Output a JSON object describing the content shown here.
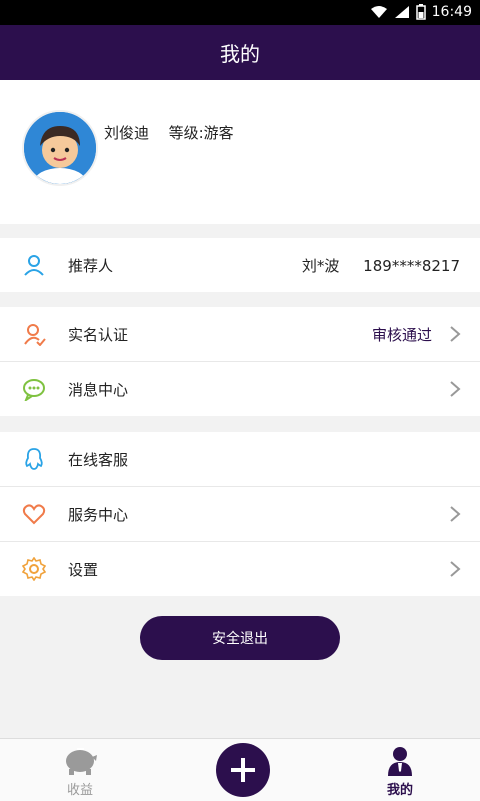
{
  "status_bar": {
    "time": "16:49"
  },
  "header": {
    "title": "我的"
  },
  "profile": {
    "name": "刘俊迪",
    "level": "等级:游客"
  },
  "referrer": {
    "label": "推荐人",
    "value": "刘*波     189****8217"
  },
  "menu_group_1": [
    {
      "label": "实名认证",
      "status": "审核通过"
    },
    {
      "label": "消息中心"
    }
  ],
  "menu_group_2": [
    {
      "label": "在线客服"
    },
    {
      "label": "服务中心"
    },
    {
      "label": "设置"
    }
  ],
  "logout_label": "安全退出",
  "tabbar": {
    "tabs": [
      {
        "label": "收益"
      },
      {
        "label": "我的"
      }
    ]
  },
  "colors": {
    "brand": "#2c0f4d",
    "active_tab": "#2c0f4d",
    "inactive_tab": "#9a9a9a"
  }
}
